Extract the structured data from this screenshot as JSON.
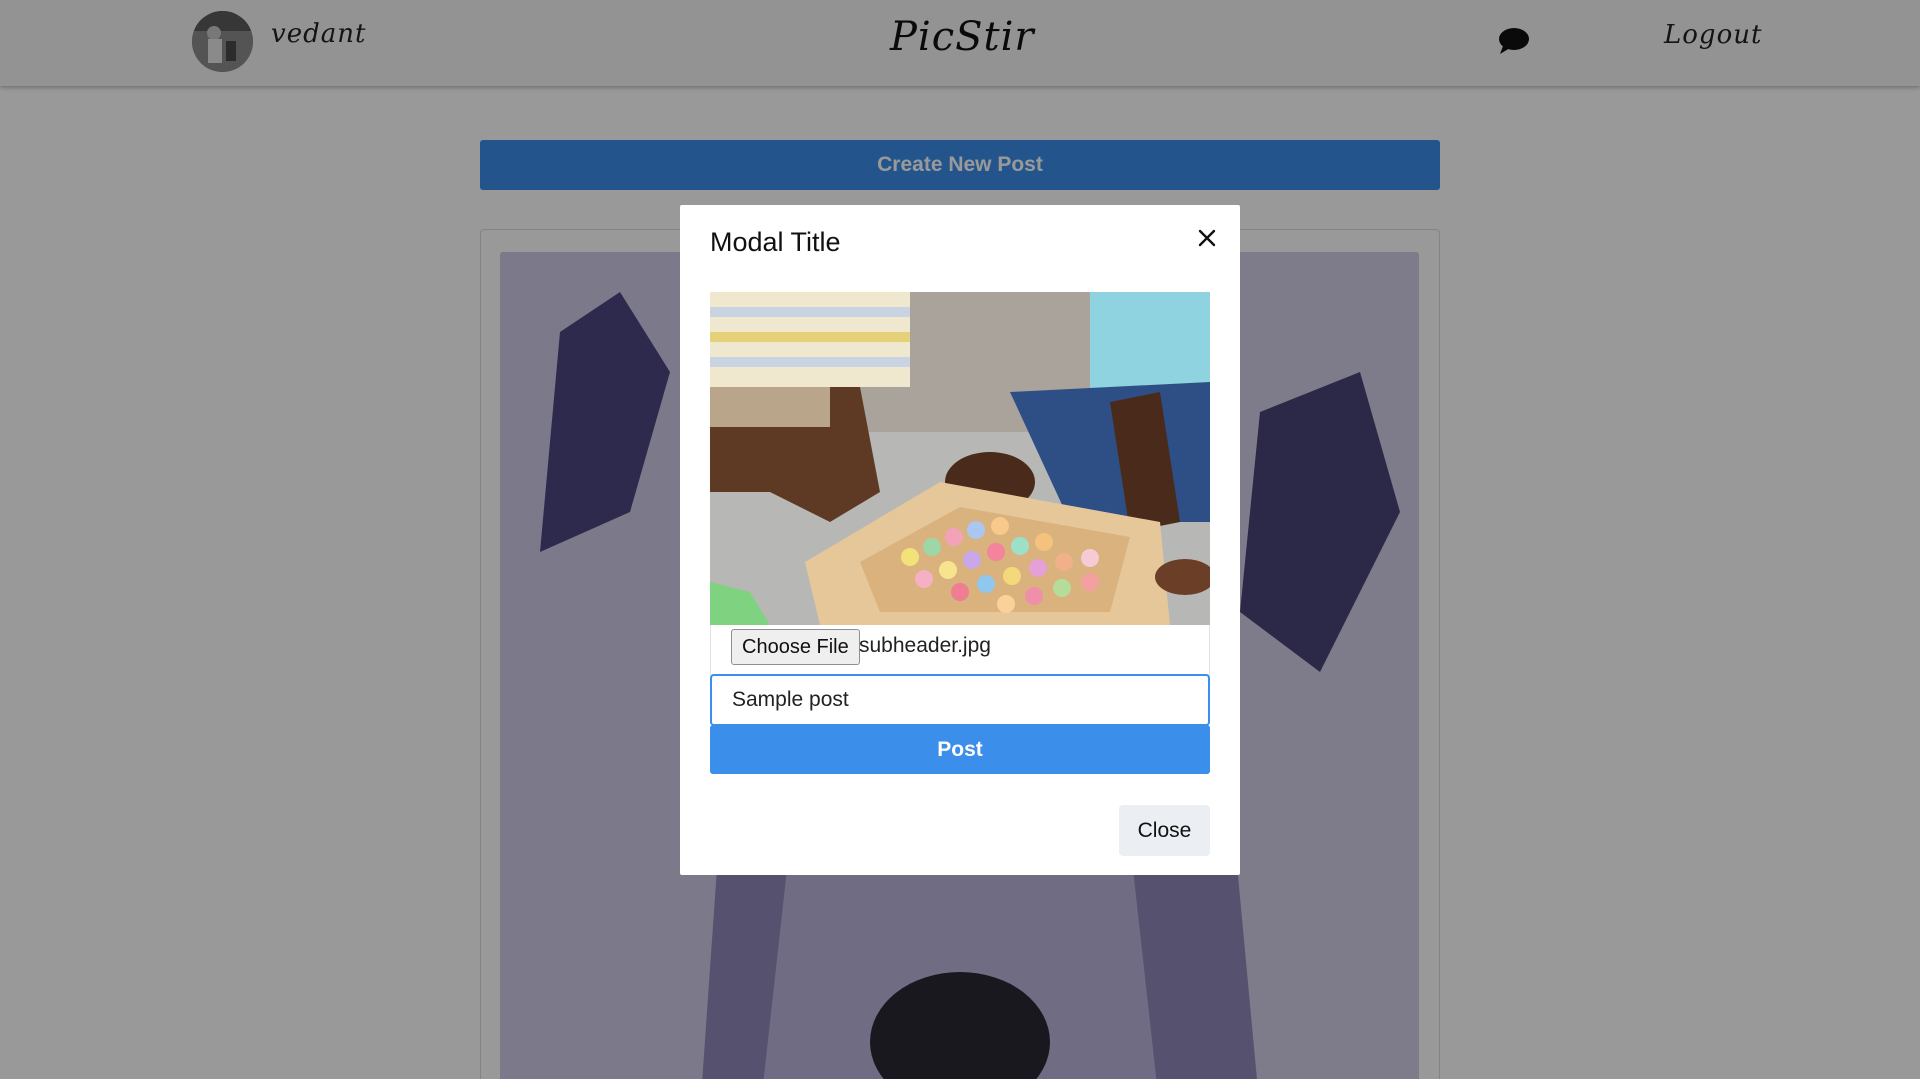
{
  "navbar": {
    "username": "vedant",
    "brand": "PicStir",
    "logout_label": "Logout",
    "avatar_icon": "user-avatar",
    "chat_icon": "chat-bubble-icon"
  },
  "main": {
    "create_post_label": "Create New Post"
  },
  "modal": {
    "title": "Modal Title",
    "close_icon": "close-icon",
    "file_button_label": "Choose File",
    "file_name": "subheader.jpg",
    "caption_value": "Sample post",
    "post_label": "Post",
    "close_label": "Close"
  },
  "colors": {
    "accent": "#3b8eea",
    "backdrop": "rgba(0,0,0,0.4)",
    "navbar_bg": "#f5f5f5",
    "close_button_bg": "#ebeef2"
  }
}
